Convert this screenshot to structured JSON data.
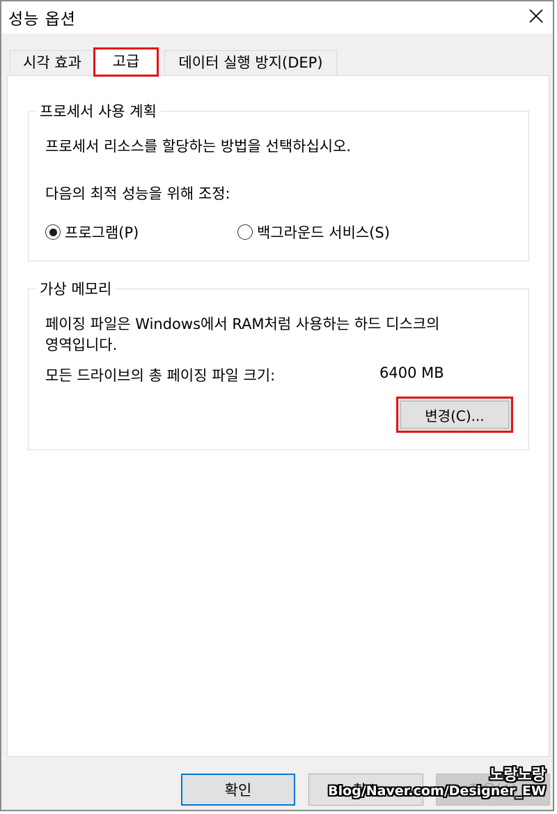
{
  "window": {
    "title": "성능 옵션",
    "close_icon": "✕"
  },
  "tabs": [
    {
      "label": "시각 효과"
    },
    {
      "label": "고급"
    },
    {
      "label": "데이터 실행 방지(DEP)"
    }
  ],
  "processor": {
    "group_title": "프로세서 사용 계획",
    "description": "프로세서 리소스를 할당하는 방법을 선택하십시오.",
    "adjust_label": "다음의 최적 성능을 위해 조정:",
    "options": [
      {
        "label": "프로그램(P)",
        "selected": true
      },
      {
        "label": "백그라운드 서비스(S)",
        "selected": false
      }
    ]
  },
  "virtual_memory": {
    "group_title": "가상 메모리",
    "description_line1": "페이징 파일은 Windows에서 RAM처럼 사용하는 하드 디스크의",
    "description_line2": "영역입니다.",
    "total_label": "모든 드라이브의 총 페이징 파일 크기:",
    "total_value": "6400 MB",
    "change_button": "변경(C)..."
  },
  "footer": {
    "ok": "확인",
    "cancel": "취소",
    "apply": "적용(A)"
  },
  "watermark": {
    "line1": "노랑노랑",
    "line2": "Blog/Naver.com/Designer_EW"
  },
  "colors": {
    "highlight": "#e61414",
    "default_button_border": "#0078d7",
    "dialog_bg": "#f0f0f0"
  }
}
